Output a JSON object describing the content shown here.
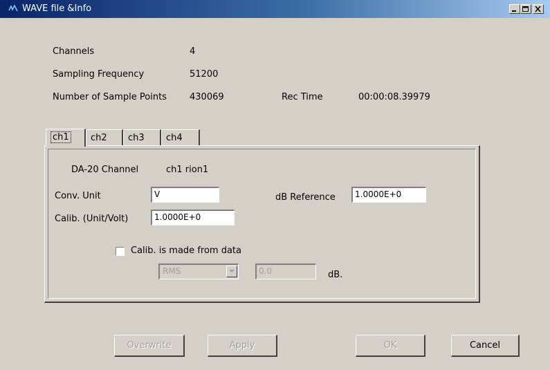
{
  "window": {
    "title": "WAVE file &Info"
  },
  "info": {
    "channels_label": "Channels",
    "channels_value": "4",
    "sampling_label": "Sampling Frequency",
    "sampling_value": "51200",
    "points_label": "Number of Sample Points",
    "points_value": "430069",
    "rectime_label": "Rec Time",
    "rectime_value": "00:00:08.39979"
  },
  "tabs": [
    {
      "label": "ch1"
    },
    {
      "label": "ch2"
    },
    {
      "label": "ch3"
    },
    {
      "label": "ch4"
    }
  ],
  "channel": {
    "da_label": "DA-20 Channel",
    "da_value": "ch1 rion1",
    "conv_unit_label": "Conv. Unit",
    "conv_unit_value": "V",
    "db_ref_label": "dB Reference",
    "db_ref_value": "1.0000E+0",
    "calib_label": "Calib. (Unit/Volt)",
    "calib_value": "1.0000E+0",
    "calib_from_data_label": "Calib. is made from data",
    "calib_from_data_checked": false,
    "calib_mode": "RMS",
    "calib_db_value": "0.0",
    "db_unit": "dB."
  },
  "buttons": {
    "overwrite": "Overwrite",
    "apply": "Apply",
    "ok": "OK",
    "cancel": "Cancel"
  },
  "colors": {
    "face": "#d4d0c8",
    "title_start": "#0a246a",
    "title_end": "#a6caf0",
    "disabled_text": "#a0a0a0"
  }
}
